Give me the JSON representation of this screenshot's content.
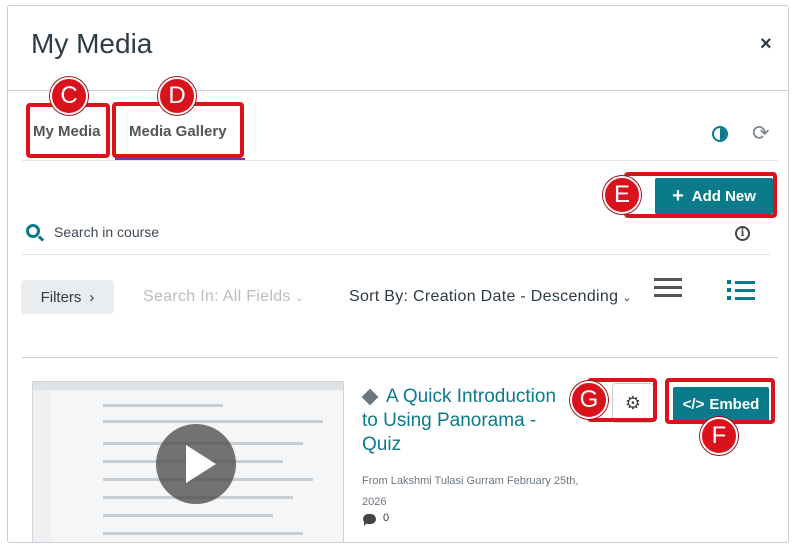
{
  "modal": {
    "title": "My Media",
    "close_glyph": "×"
  },
  "tabs": [
    {
      "label": "My Media"
    },
    {
      "label": "Media Gallery"
    }
  ],
  "toolbar": {
    "contrast_icon": "contrast-icon",
    "refresh_icon": "refresh-icon",
    "refresh_glyph": "⟳"
  },
  "actions": {
    "add_new_label": "Add New",
    "add_new_glyph": "+"
  },
  "search": {
    "placeholder": "Search in course",
    "info_glyph": "i"
  },
  "filter_bar": {
    "filters_label": "Filters",
    "filters_chevron": "›",
    "search_in": "Search In: All Fields",
    "sort_by": "Sort By: Creation Date - Descending",
    "dropdown_glyph": "⌄"
  },
  "media_item": {
    "title": "A Quick Introduction to Using Panorama - Quiz",
    "meta": "From Lakshmi Tulasi Gurram February 25th, 2026",
    "comment_count": "0",
    "embed_label": "Embed",
    "embed_glyph": "</>",
    "settings_glyph": "⚙"
  },
  "callouts": [
    "C",
    "D",
    "E",
    "F",
    "G"
  ],
  "colors": {
    "accent": "#0b7a8a",
    "callout": "#d9121c",
    "tab_active": "#6a3bb3"
  }
}
